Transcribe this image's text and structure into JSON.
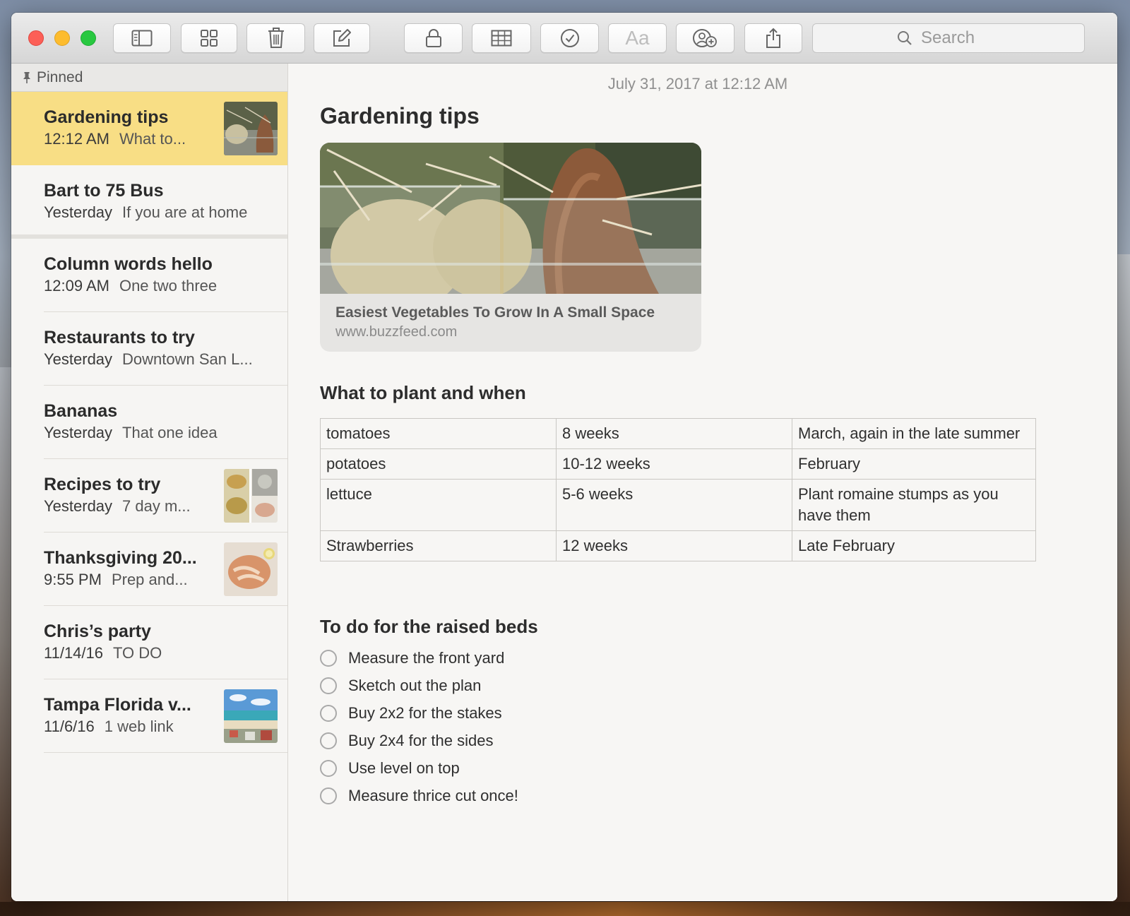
{
  "toolbar": {
    "search_placeholder": "Search",
    "format_label": "Aa",
    "buttons": [
      "sidebar-toggle",
      "gallery-view",
      "delete",
      "compose",
      "lock",
      "table",
      "checklist",
      "format",
      "add-people",
      "share"
    ]
  },
  "sidebar": {
    "pinned_label": "Pinned",
    "notes": [
      {
        "title": "Gardening tips",
        "date": "12:12 AM",
        "snippet": "What to...",
        "has_thumb": true,
        "selected": true
      },
      {
        "title": "Bart to 75 Bus",
        "date": "Yesterday",
        "snippet": "If you are at home",
        "has_thumb": false
      },
      {
        "title": "Column words hello",
        "date": "12:09 AM",
        "snippet": "One two three",
        "has_thumb": false
      },
      {
        "title": "Restaurants to try",
        "date": "Yesterday",
        "snippet": "Downtown San L...",
        "has_thumb": false
      },
      {
        "title": "Bananas",
        "date": "Yesterday",
        "snippet": "That one idea",
        "has_thumb": false
      },
      {
        "title": "Recipes to try",
        "date": "Yesterday",
        "snippet": "7 day m...",
        "has_thumb": true
      },
      {
        "title": "Thanksgiving 20...",
        "date": "9:55 PM",
        "snippet": "Prep and...",
        "has_thumb": true
      },
      {
        "title": "Chris’s party",
        "date": "11/14/16",
        "snippet": "TO DO",
        "has_thumb": false
      },
      {
        "title": "Tampa Florida v...",
        "date": "11/6/16",
        "snippet": "1 web link",
        "has_thumb": true
      }
    ]
  },
  "editor": {
    "timestamp": "July 31, 2017 at 12:12 AM",
    "title": "Gardening tips",
    "link": {
      "title": "Easiest Vegetables To Grow In A Small Space",
      "url": "www.buzzfeed.com"
    },
    "table_heading": "What to plant and when",
    "table": [
      [
        "tomatoes",
        "8 weeks",
        "March, again in the late summer"
      ],
      [
        "potatoes",
        "10-12 weeks",
        "February"
      ],
      [
        "lettuce",
        "5-6 weeks",
        "Plant romaine stumps as you have them"
      ],
      [
        "Strawberries",
        "12 weeks",
        "Late February"
      ]
    ],
    "todo_heading": "To do for the raised beds",
    "todos": [
      "Measure the front yard",
      "Sketch out the plan",
      "Buy 2x2 for the stakes",
      "Buy 2x4 for the sides",
      "Use level on top",
      "Measure thrice cut once!"
    ]
  },
  "colors": {
    "selected_note": "#f8de85",
    "close": "#fc5f57",
    "minimize": "#fdbc2e",
    "zoom": "#28c840"
  }
}
